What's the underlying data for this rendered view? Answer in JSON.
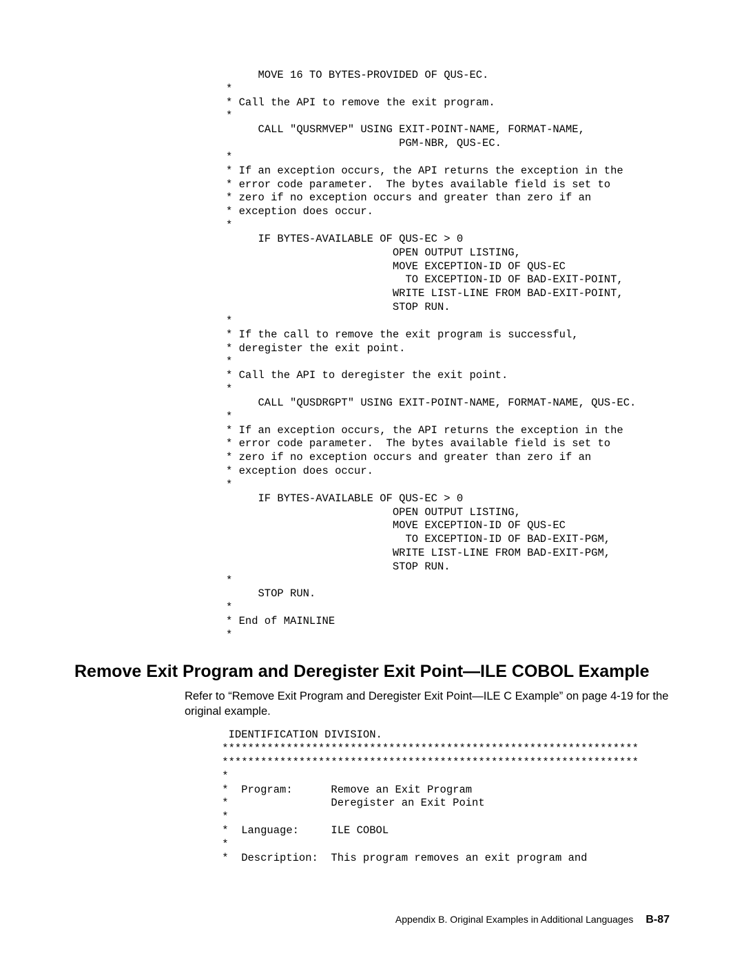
{
  "code1": "     MOVE 16 TO BYTES-PROVIDED OF QUS-EC.\n*\n* Call the API to remove the exit program.\n*\n     CALL \"QUSRMVEP\" USING EXIT-POINT-NAME, FORMAT-NAME,\n                           PGM-NBR, QUS-EC.\n*\n* If an exception occurs, the API returns the exception in the\n* error code parameter.  The bytes available field is set to\n* zero if no exception occurs and greater than zero if an\n* exception does occur.\n*\n     IF BYTES-AVAILABLE OF QUS-EC > 0\n                          OPEN OUTPUT LISTING,\n                          MOVE EXCEPTION-ID OF QUS-EC\n                            TO EXCEPTION-ID OF BAD-EXIT-POINT,\n                          WRITE LIST-LINE FROM BAD-EXIT-POINT,\n                          STOP RUN.\n*\n* If the call to remove the exit program is successful,\n* deregister the exit point.\n*\n* Call the API to deregister the exit point.\n*\n     CALL \"QUSDRGPT\" USING EXIT-POINT-NAME, FORMAT-NAME, QUS-EC.\n*\n* If an exception occurs, the API returns the exception in the\n* error code parameter.  The bytes available field is set to\n* zero if no exception occurs and greater than zero if an\n* exception does occur.\n*\n     IF BYTES-AVAILABLE OF QUS-EC > 0\n                          OPEN OUTPUT LISTING,\n                          MOVE EXCEPTION-ID OF QUS-EC\n                            TO EXCEPTION-ID OF BAD-EXIT-PGM,\n                          WRITE LIST-LINE FROM BAD-EXIT-PGM,\n                          STOP RUN.\n*\n     STOP RUN.\n*\n* End of MAINLINE\n*",
  "heading": "Remove Exit Program and Deregister Exit Point—ILE COBOL Example",
  "refer": "Refer to “Remove Exit Program and Deregister Exit Point—ILE C Example” on page 4-19 for the original example.",
  "code2": "  IDENTIFICATION DIVISION.\n *****************************************************************\n *****************************************************************\n *\n *  Program:      Remove an Exit Program\n *                Deregister an Exit Point\n *\n *  Language:     ILE COBOL\n *\n *  Description:  This program removes an exit program and",
  "footer": {
    "text": "Appendix B.  Original Examples in Additional Languages",
    "page": "B-87"
  }
}
